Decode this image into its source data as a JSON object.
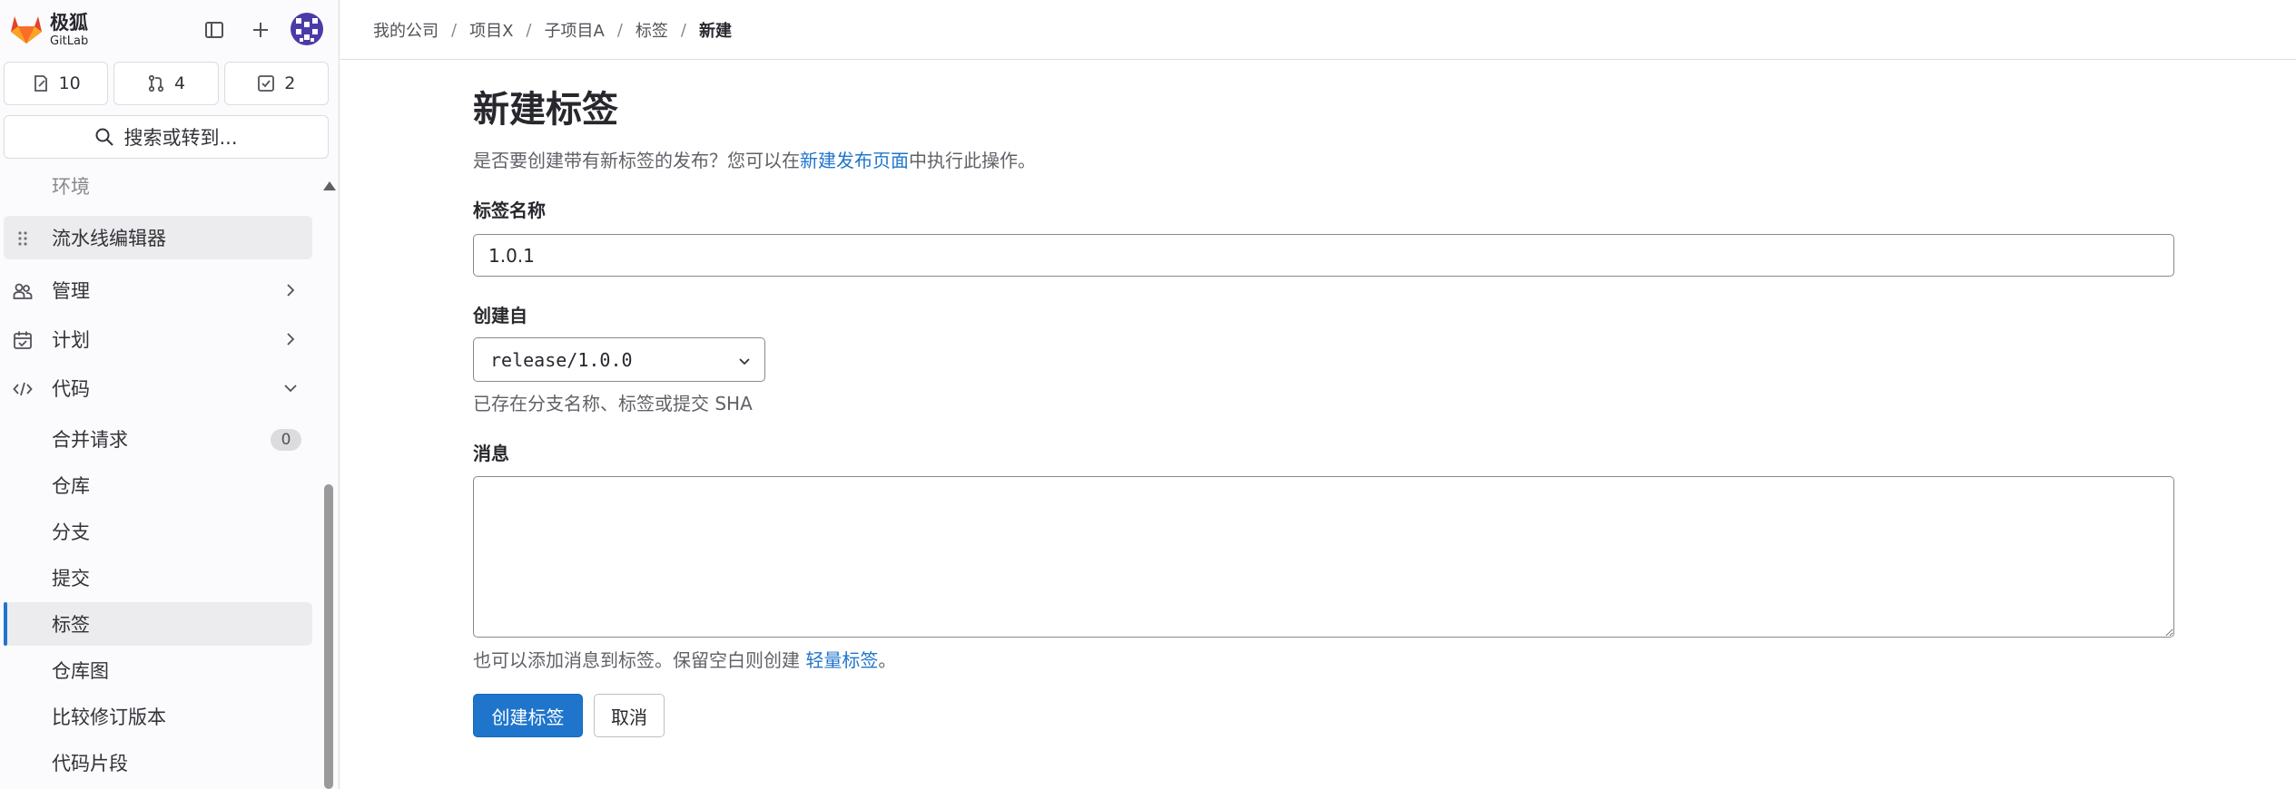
{
  "sidebar": {
    "brand_name": "极狐",
    "brand_sub": "GitLab",
    "counters": [
      {
        "icon": "issue-icon",
        "count": "10"
      },
      {
        "icon": "merge-request-icon",
        "count": "4"
      },
      {
        "icon": "todo-icon",
        "count": "2"
      }
    ],
    "search_label": "搜索或转到...",
    "items": {
      "environments": "环境",
      "pipeline_editor": "流水线编辑器",
      "manage": "管理",
      "plan": "计划",
      "code": "代码",
      "merge_requests": "合并请求",
      "merge_requests_count": "0",
      "repository": "仓库",
      "branches": "分支",
      "commits": "提交",
      "tags": "标签",
      "repo_graph": "仓库图",
      "compare": "比较修订版本",
      "snippets": "代码片段"
    }
  },
  "breadcrumb": {
    "b1": "我的公司",
    "b2": "项目X",
    "b3": "子项目A",
    "b4": "标签",
    "b5": "新建"
  },
  "page": {
    "title": "新建标签",
    "desc_before": "是否要创建带有新标签的发布？您可以在",
    "desc_link": "新建发布页面",
    "desc_after": "中执行此操作。",
    "tag_name_label": "标签名称",
    "tag_name_value": "1.0.1",
    "create_from_label": "创建自",
    "create_from_value": "release/1.0.0",
    "create_from_help": "已存在分支名称、标签或提交 SHA",
    "message_label": "消息",
    "message_help_before": "也可以添加消息到标签。保留空白则创建 ",
    "message_help_link": "轻量标签",
    "message_help_after": "。",
    "create_button": "创建标签",
    "cancel_button": "取消"
  },
  "colors": {
    "accent": "#1f75cb",
    "brand_orange": "#fc6d26"
  }
}
